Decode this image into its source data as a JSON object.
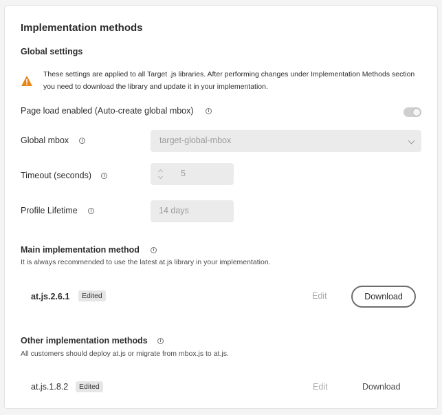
{
  "page": {
    "title": "Implementation methods",
    "global_settings_heading": "Global settings",
    "warning_text": "These settings are applied to all Target .js libraries. After performing changes under Implementation Methods section you need to download the library and update it in your implementation."
  },
  "settings": {
    "page_load_label": "Page load enabled (Auto-create global mbox)",
    "page_load_enabled": true,
    "global_mbox_label": "Global mbox",
    "global_mbox_value": "target-global-mbox",
    "timeout_label": "Timeout (seconds)",
    "timeout_value": "5",
    "profile_lifetime_label": "Profile Lifetime",
    "profile_lifetime_value": "14 days"
  },
  "main_method": {
    "heading": "Main implementation method",
    "description": "It is always recommended to use the latest at.js library in your implementation.",
    "library": "at.js.2.6.1",
    "badge": "Edited",
    "edit_label": "Edit",
    "download_label": "Download"
  },
  "other_methods": {
    "heading": "Other implementation methods",
    "description": "All customers should deploy at.js or migrate from mbox.js to at.js.",
    "library": "at.js.1.8.2",
    "badge": "Edited",
    "edit_label": "Edit",
    "download_label": "Download"
  },
  "icons": {
    "warning": "warning-triangle-icon",
    "info": "info-icon",
    "chevron": "chevron-down-icon"
  },
  "colors": {
    "warning": "#e68619",
    "field_bg": "#ebebeb",
    "toggle_off": "#cfcfcf"
  }
}
